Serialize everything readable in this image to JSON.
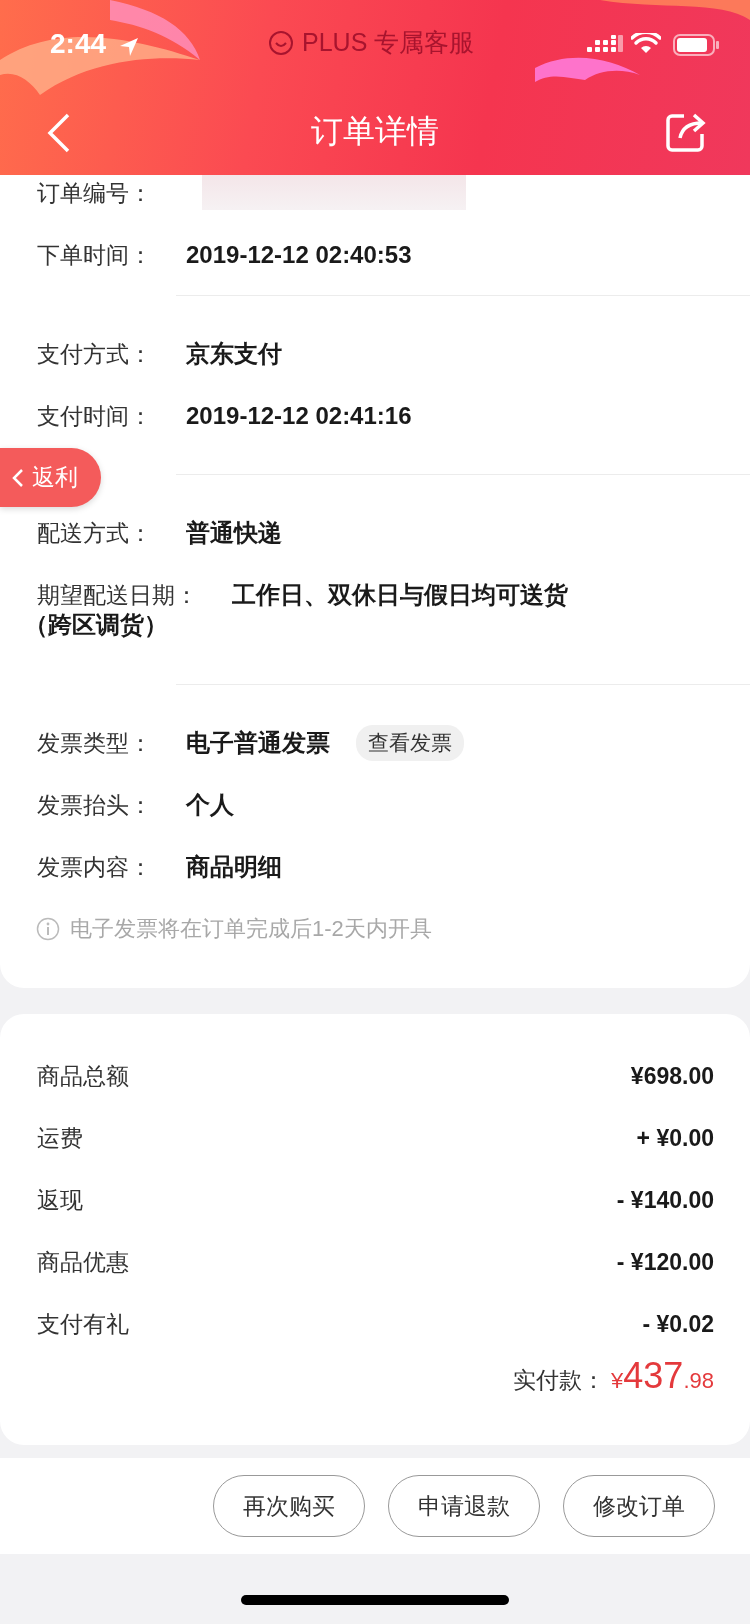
{
  "status_bar": {
    "time": "2:44"
  },
  "header": {
    "service_label": "PLUS 专属客服",
    "title": "订单详情"
  },
  "rebate_tab": {
    "label": "返利"
  },
  "order_info": {
    "groups": [
      {
        "rows": [
          {
            "kind": "redacted",
            "label": "订单编号："
          },
          {
            "kind": "text",
            "label": "下单时间：",
            "value": "2019-12-12 02:40:53"
          }
        ]
      },
      {
        "rows": [
          {
            "kind": "text",
            "label": "支付方式：",
            "value": "京东支付"
          },
          {
            "kind": "text",
            "label": "支付时间：",
            "value": "2019-12-12 02:41:16"
          }
        ]
      },
      {
        "rows": [
          {
            "kind": "text",
            "label": "配送方式：",
            "value": "普通快递"
          },
          {
            "kind": "wrapped",
            "label": "期望配送日期：",
            "value": "工作日、双休日与假日均可送货",
            "continuation": "（跨区调货）"
          }
        ]
      },
      {
        "rows": [
          {
            "kind": "button",
            "label": "发票类型：",
            "value": "电子普通发票",
            "button": "查看发票"
          },
          {
            "kind": "text",
            "label": "发票抬头：",
            "value": "个人"
          },
          {
            "kind": "text",
            "label": "发票内容：",
            "value": "商品明细"
          }
        ],
        "notice": "电子发票将在订单完成后1-2天内开具"
      }
    ]
  },
  "price_summary": {
    "rows": [
      {
        "label": "商品总额",
        "amount": "¥698.00"
      },
      {
        "label": "运费",
        "amount": "+ ¥0.00"
      },
      {
        "label": "返现",
        "amount": "- ¥140.00"
      },
      {
        "label": "商品优惠",
        "amount": "- ¥120.00"
      },
      {
        "label": "支付有礼",
        "amount": "- ¥0.02"
      }
    ],
    "total": {
      "label": "实付款：",
      "currency": "¥",
      "integer": "437",
      "decimal": ".98"
    }
  },
  "actions": [
    "再次购买",
    "申请退款",
    "修改订单"
  ]
}
